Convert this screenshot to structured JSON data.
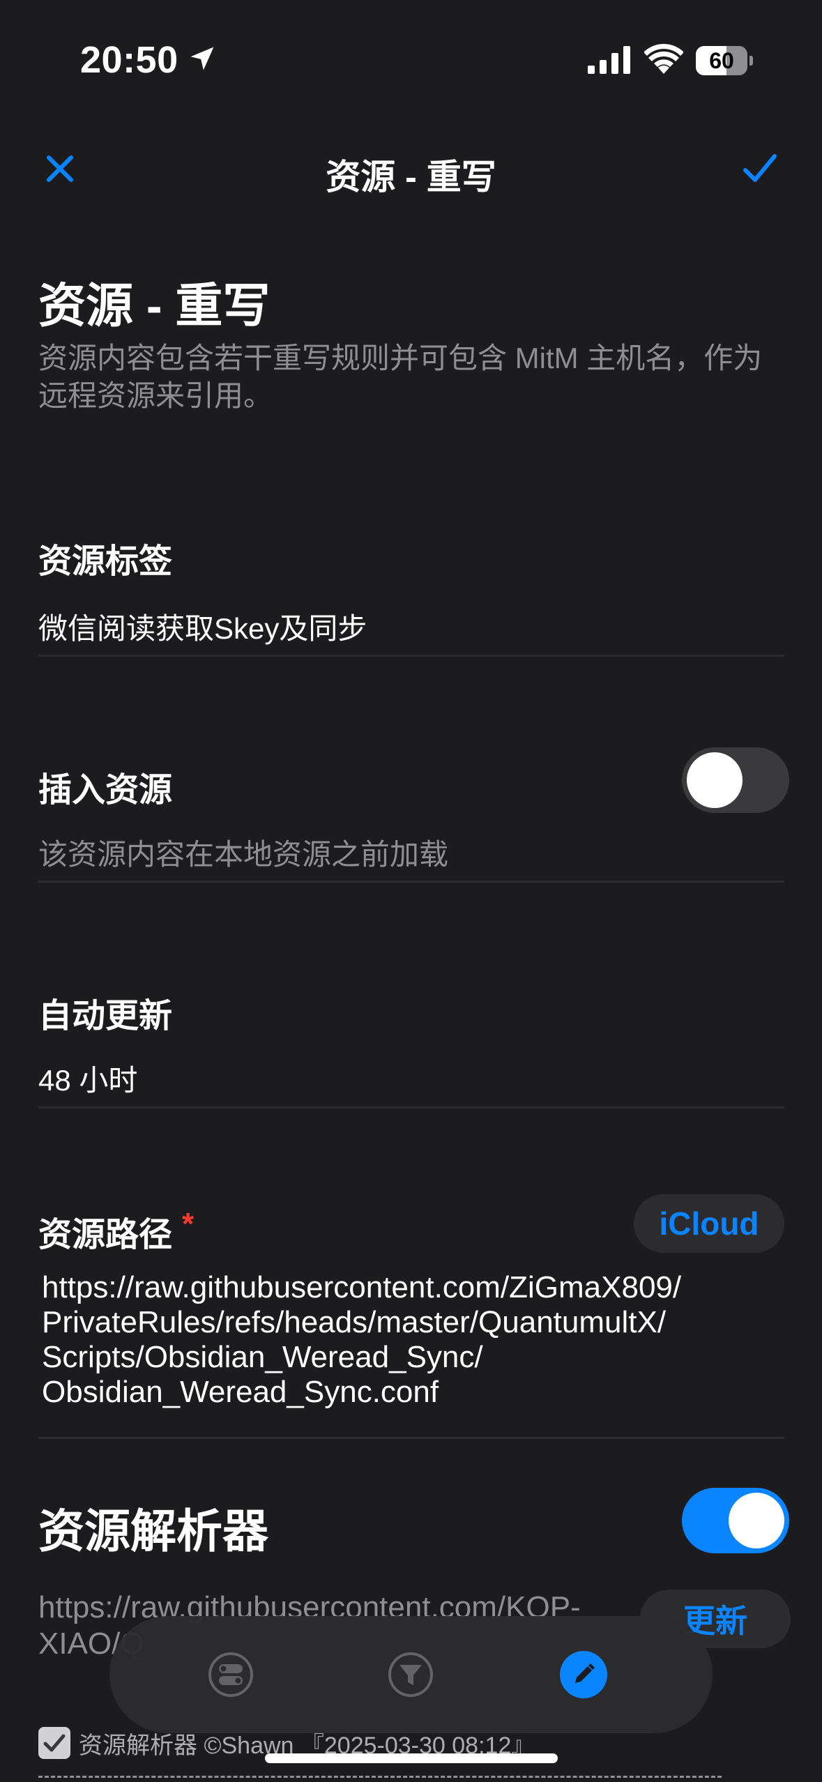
{
  "status_bar": {
    "time": "20:50",
    "battery_level": "60",
    "battery_fraction": 0.6
  },
  "nav": {
    "title": "资源 - 重写",
    "close_icon": "close-icon",
    "confirm_icon": "checkmark-icon"
  },
  "header": {
    "title": "资源 - 重写",
    "description": "资源内容包含若干重写规则并可包含 MitM 主机名，作为远程资源来引用。"
  },
  "tag_section": {
    "label": "资源标签",
    "value": "微信阅读获取Skey及同步"
  },
  "insert_section": {
    "label": "插入资源",
    "hint": "该资源内容在本地资源之前加载",
    "enabled": false
  },
  "update_section": {
    "label": "自动更新",
    "value": "48 小时"
  },
  "path_section": {
    "label": "资源路径",
    "required_mark": "*",
    "icloud_button": "iCloud",
    "path_lines": [
      "https://raw.githubusercontent.com/ZiGmaX809/",
      "PrivateRules/refs/heads/master/QuantumultX/",
      "Scripts/Obsidian_Weread_Sync/",
      "Obsidian_Weread_Sync.conf"
    ]
  },
  "parser_section": {
    "title": "资源解析器",
    "enabled": true,
    "url_lines": [
      "https://raw.githubusercontent.com/KOP-",
      "XIAO/Q"
    ],
    "update_button": "更新",
    "checkbox_label": "资源解析器 ©Shawn 『2025-03-30 08:12』",
    "checked": true
  },
  "tab_bar": {
    "tabs": [
      {
        "name": "toggles-icon",
        "active": false
      },
      {
        "name": "filter-icon",
        "active": false
      },
      {
        "name": "edit-icon",
        "active": true
      }
    ]
  },
  "colors": {
    "accent": "#0a84ff",
    "background": "#1c1c1e",
    "secondary_text": "#8e8e93",
    "required": "#ff3b30"
  }
}
